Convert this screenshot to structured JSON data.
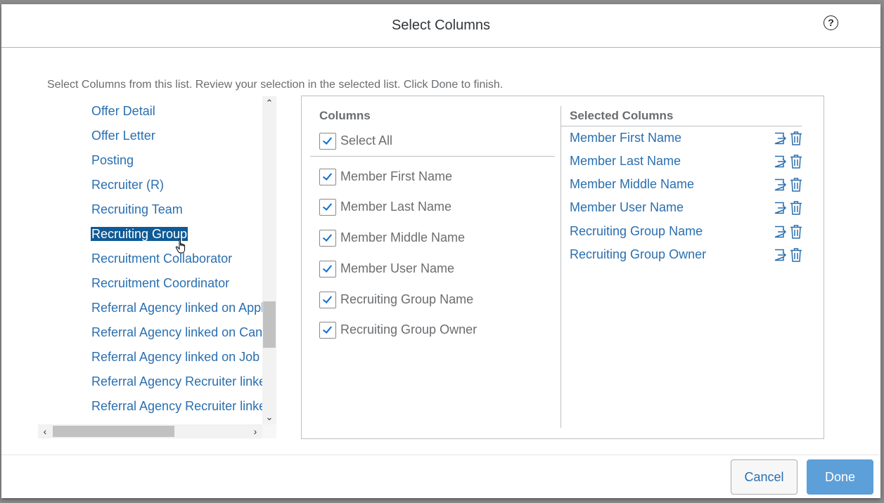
{
  "dialog": {
    "title": "Select Columns",
    "help_icon": "help-circle-icon",
    "instructions": "Select Columns from this list. Review your selection in the selected list. Click Done to finish."
  },
  "left_list": {
    "items": [
      "Offer Detail",
      "Offer Letter",
      "Posting",
      "Recruiter (R)",
      "Recruiting Team",
      "Recruiting Group",
      "Recruitment Collaborator",
      "Recruitment Coordinator",
      "Referral Agency linked on Applic",
      "Referral Agency linked on Candi",
      "Referral Agency linked on Job R",
      "Referral Agency Recruiter linked",
      "Referral Agency Recruiter linked"
    ],
    "selected_item": "Recruiting Group"
  },
  "columns": {
    "title": "Columns",
    "select_all": "Select All",
    "items": [
      {
        "label": "Member First Name",
        "checked": true
      },
      {
        "label": "Member Last Name",
        "checked": true
      },
      {
        "label": "Member Middle Name",
        "checked": true
      },
      {
        "label": "Member User Name",
        "checked": true
      },
      {
        "label": "Recruiting Group Name",
        "checked": true
      },
      {
        "label": "Recruiting Group Owner",
        "checked": true
      }
    ]
  },
  "selected_columns": {
    "title": "Selected Columns",
    "items": [
      "Member First Name",
      "Member Last Name",
      "Member Middle Name",
      "Member User Name",
      "Recruiting Group Name",
      "Recruiting Group Owner"
    ]
  },
  "footer": {
    "cancel_label": "Cancel",
    "done_label": "Done"
  },
  "colors": {
    "link": "#2a6fb0",
    "selected_bg": "#0f5a96",
    "primary_button": "#5d9fd8",
    "check": "#0a6ed1"
  }
}
